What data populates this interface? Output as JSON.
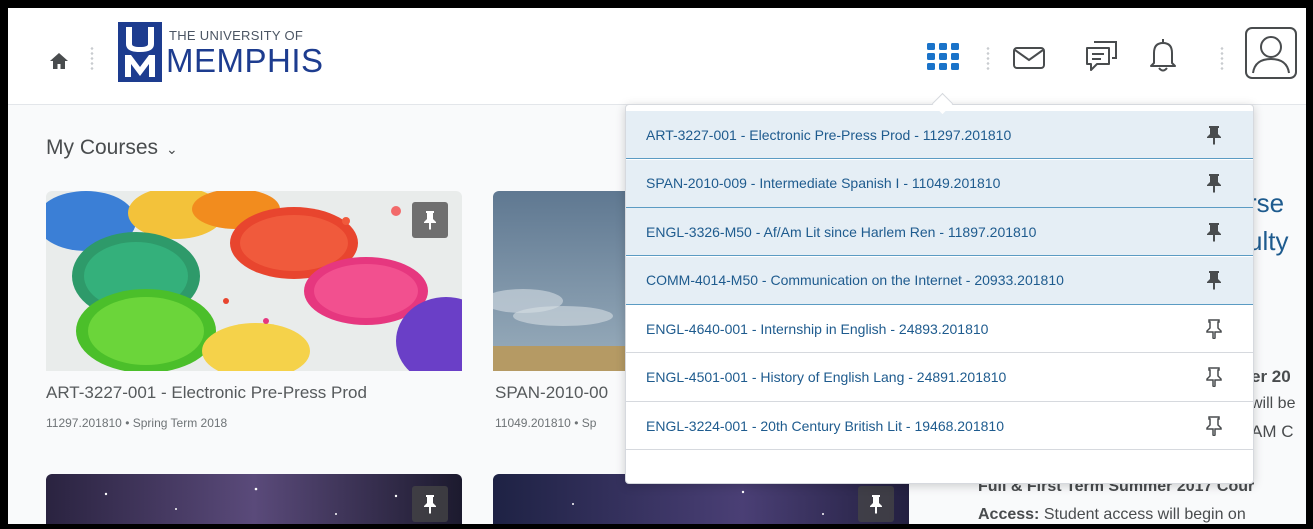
{
  "header": {
    "logo_small": "THE UNIVERSITY OF",
    "logo_big": "MEMPHIS",
    "logo_mark_letters": "UM",
    "icons": [
      "home-icon",
      "course-selector-grid-icon",
      "mail-icon",
      "chat-icon",
      "bell-icon",
      "user-avatar-icon"
    ]
  },
  "my_courses": {
    "label": "My Courses",
    "chevron": "⌄"
  },
  "cards": [
    {
      "title": "ART-3227-001 - Electronic Pre-Press Prod",
      "code": "11297.201810",
      "term": "Spring Term 2018",
      "sub": "11297.201810 • Spring Term 2018"
    },
    {
      "title": "SPAN-2010-00",
      "code": "11049.201810",
      "term": "Sp",
      "sub": "11049.201810 • Sp"
    }
  ],
  "dropdown": {
    "items": [
      {
        "label": "ART-3227-001 - Electronic Pre-Press Prod - 11297.201810",
        "pinned": true
      },
      {
        "label": "SPAN-2010-009 - Intermediate Spanish I - 11049.201810",
        "pinned": true
      },
      {
        "label": "ENGL-3326-M50 - Af/Am Lit since Harlem Ren - 11897.201810",
        "pinned": true
      },
      {
        "label": "COMM-4014-M50 - Communication on the Internet - 20933.201810",
        "pinned": true
      },
      {
        "label": "ENGL-4640-001 - Internship in English - 24893.201810",
        "pinned": false
      },
      {
        "label": "ENGL-4501-001 - History of English Lang - 24891.201810",
        "pinned": false
      },
      {
        "label": "ENGL-3224-001 - 20th Century British Lit - 19468.201810",
        "pinned": false
      }
    ]
  },
  "right_panel": {
    "heading_1": "rse",
    "heading_2": "ulty",
    "frag_1": "er 20",
    "frag_2": "will be",
    "frag_3": "AM C",
    "summer_heading": "Full & First Term Summer 2017 Cour",
    "access_label": "Access:",
    "access_text": "Student access will begin on"
  },
  "colors": {
    "brand_blue": "#1d3c8f",
    "link_blue": "#1e5b8e",
    "pinned_bg": "#e5eef5",
    "grid_icon": "#1a73c9"
  }
}
